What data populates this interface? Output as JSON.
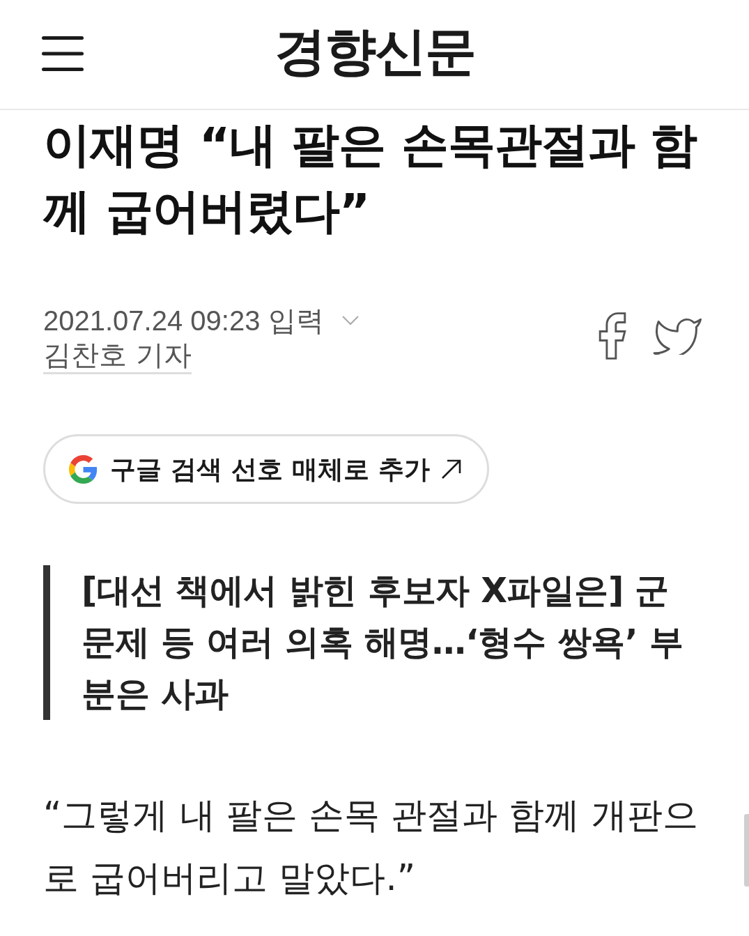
{
  "header": {
    "logo": "경향신문"
  },
  "article": {
    "headline": "이재명 “내 팔은 손목관절과 함께 굽어버렸다”",
    "published": "2021.07.24 09:23 입력",
    "byline": "김찬호 기자",
    "share": [
      {
        "kind": "facebook"
      },
      {
        "kind": "twitter"
      }
    ]
  },
  "google_button": {
    "label": "구글 검색 선호 매체로 추가"
  },
  "subheading": "[대선 책에서 밝힌 후보자 X파일은] 군 문제 등 여러 의혹 해명…‘형수 쌍욕’ 부분은 사과",
  "body": [
    "“그렇게 내 팔은 손목 관절과 함께 개판으로 굽어버리고 말았다.”"
  ]
}
